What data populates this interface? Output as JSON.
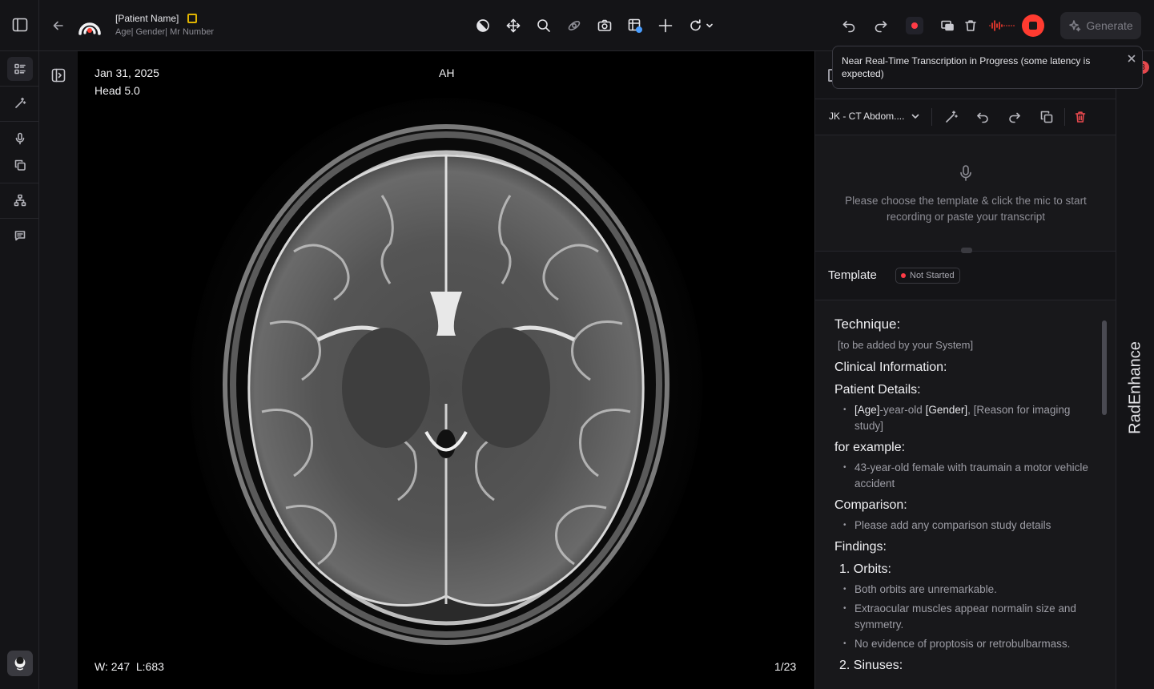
{
  "patient": {
    "name": "[Patient Name]",
    "meta": "Age| Gender| Mr Number"
  },
  "header": {
    "generate_label": "Generate"
  },
  "viewer": {
    "date": "Jan 31, 2025",
    "series": "Head 5.0",
    "orientation": "AH",
    "window_level": "W: 247  L:683",
    "slice": "1/23"
  },
  "toast": {
    "message": "Near Real-Time Transcription in Progress (some latency is expected)"
  },
  "right_panel": {
    "template_select": "JK - CT Abdom....",
    "recording_hint": "Please choose the template & click the mic to start recording or paste your transcript",
    "template_title": "Template",
    "status": "Not Started",
    "status_color": "#ff3b46",
    "side_label": "RadEnhance",
    "notification_count": "3"
  },
  "document": {
    "technique_heading": "Technique:",
    "technique_text": "[to be added by your System]",
    "clinical_heading": "Clinical Information:",
    "patient_details_heading": "Patient Details:",
    "patient_details_age": "[Age]",
    "patient_details_mid": "-year-old ",
    "patient_details_gender": "[Gender]",
    "patient_details_reason": ", [Reason for imaging study]",
    "example_heading": "for example:",
    "example_item": "43-year-old female with traumain a motor vehicle accident",
    "comparison_heading": "Comparison:",
    "comparison_item": "Please add any comparison study details",
    "findings_heading": "Findings:",
    "orbits_heading": "1. Orbits:",
    "orbits_items": [
      "Both orbits are unremarkable.",
      "Extraocular muscles appear normalin size and symmetry.",
      "No evidence of proptosis or retrobulbarmass."
    ],
    "sinuses_heading": "2. Sinuses:"
  },
  "colors": {
    "accent_red": "#ff3b30",
    "flag_yellow": "#e0b400",
    "background": "#0d0d0f"
  }
}
